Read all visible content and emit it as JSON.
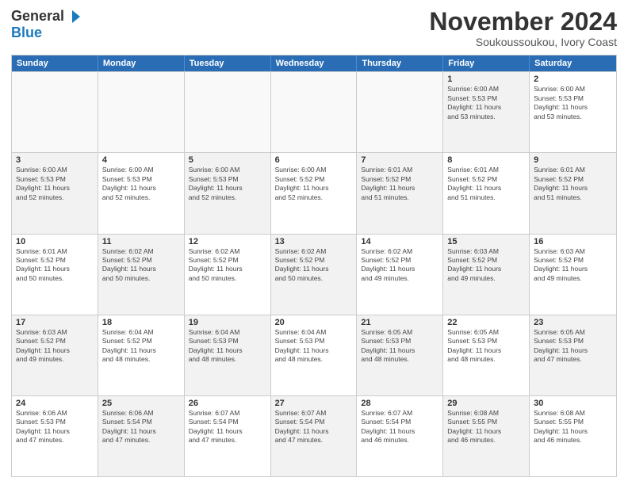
{
  "header": {
    "logo_general": "General",
    "logo_blue": "Blue",
    "month_title": "November 2024",
    "location": "Soukoussoukou, Ivory Coast"
  },
  "days_of_week": [
    "Sunday",
    "Monday",
    "Tuesday",
    "Wednesday",
    "Thursday",
    "Friday",
    "Saturday"
  ],
  "weeks": [
    [
      {
        "day": "",
        "info": "",
        "empty": true
      },
      {
        "day": "",
        "info": "",
        "empty": true
      },
      {
        "day": "",
        "info": "",
        "empty": true
      },
      {
        "day": "",
        "info": "",
        "empty": true
      },
      {
        "day": "",
        "info": "",
        "empty": true
      },
      {
        "day": "1",
        "info": "Sunrise: 6:00 AM\nSunset: 5:53 PM\nDaylight: 11 hours\nand 53 minutes.",
        "shaded": true
      },
      {
        "day": "2",
        "info": "Sunrise: 6:00 AM\nSunset: 5:53 PM\nDaylight: 11 hours\nand 53 minutes.",
        "shaded": false
      }
    ],
    [
      {
        "day": "3",
        "info": "Sunrise: 6:00 AM\nSunset: 5:53 PM\nDaylight: 11 hours\nand 52 minutes.",
        "shaded": true
      },
      {
        "day": "4",
        "info": "Sunrise: 6:00 AM\nSunset: 5:53 PM\nDaylight: 11 hours\nand 52 minutes.",
        "shaded": false
      },
      {
        "day": "5",
        "info": "Sunrise: 6:00 AM\nSunset: 5:53 PM\nDaylight: 11 hours\nand 52 minutes.",
        "shaded": true
      },
      {
        "day": "6",
        "info": "Sunrise: 6:00 AM\nSunset: 5:52 PM\nDaylight: 11 hours\nand 52 minutes.",
        "shaded": false
      },
      {
        "day": "7",
        "info": "Sunrise: 6:01 AM\nSunset: 5:52 PM\nDaylight: 11 hours\nand 51 minutes.",
        "shaded": true
      },
      {
        "day": "8",
        "info": "Sunrise: 6:01 AM\nSunset: 5:52 PM\nDaylight: 11 hours\nand 51 minutes.",
        "shaded": false
      },
      {
        "day": "9",
        "info": "Sunrise: 6:01 AM\nSunset: 5:52 PM\nDaylight: 11 hours\nand 51 minutes.",
        "shaded": true
      }
    ],
    [
      {
        "day": "10",
        "info": "Sunrise: 6:01 AM\nSunset: 5:52 PM\nDaylight: 11 hours\nand 50 minutes.",
        "shaded": false
      },
      {
        "day": "11",
        "info": "Sunrise: 6:02 AM\nSunset: 5:52 PM\nDaylight: 11 hours\nand 50 minutes.",
        "shaded": true
      },
      {
        "day": "12",
        "info": "Sunrise: 6:02 AM\nSunset: 5:52 PM\nDaylight: 11 hours\nand 50 minutes.",
        "shaded": false
      },
      {
        "day": "13",
        "info": "Sunrise: 6:02 AM\nSunset: 5:52 PM\nDaylight: 11 hours\nand 50 minutes.",
        "shaded": true
      },
      {
        "day": "14",
        "info": "Sunrise: 6:02 AM\nSunset: 5:52 PM\nDaylight: 11 hours\nand 49 minutes.",
        "shaded": false
      },
      {
        "day": "15",
        "info": "Sunrise: 6:03 AM\nSunset: 5:52 PM\nDaylight: 11 hours\nand 49 minutes.",
        "shaded": true
      },
      {
        "day": "16",
        "info": "Sunrise: 6:03 AM\nSunset: 5:52 PM\nDaylight: 11 hours\nand 49 minutes.",
        "shaded": false
      }
    ],
    [
      {
        "day": "17",
        "info": "Sunrise: 6:03 AM\nSunset: 5:52 PM\nDaylight: 11 hours\nand 49 minutes.",
        "shaded": true
      },
      {
        "day": "18",
        "info": "Sunrise: 6:04 AM\nSunset: 5:52 PM\nDaylight: 11 hours\nand 48 minutes.",
        "shaded": false
      },
      {
        "day": "19",
        "info": "Sunrise: 6:04 AM\nSunset: 5:53 PM\nDaylight: 11 hours\nand 48 minutes.",
        "shaded": true
      },
      {
        "day": "20",
        "info": "Sunrise: 6:04 AM\nSunset: 5:53 PM\nDaylight: 11 hours\nand 48 minutes.",
        "shaded": false
      },
      {
        "day": "21",
        "info": "Sunrise: 6:05 AM\nSunset: 5:53 PM\nDaylight: 11 hours\nand 48 minutes.",
        "shaded": true
      },
      {
        "day": "22",
        "info": "Sunrise: 6:05 AM\nSunset: 5:53 PM\nDaylight: 11 hours\nand 48 minutes.",
        "shaded": false
      },
      {
        "day": "23",
        "info": "Sunrise: 6:05 AM\nSunset: 5:53 PM\nDaylight: 11 hours\nand 47 minutes.",
        "shaded": true
      }
    ],
    [
      {
        "day": "24",
        "info": "Sunrise: 6:06 AM\nSunset: 5:53 PM\nDaylight: 11 hours\nand 47 minutes.",
        "shaded": false
      },
      {
        "day": "25",
        "info": "Sunrise: 6:06 AM\nSunset: 5:54 PM\nDaylight: 11 hours\nand 47 minutes.",
        "shaded": true
      },
      {
        "day": "26",
        "info": "Sunrise: 6:07 AM\nSunset: 5:54 PM\nDaylight: 11 hours\nand 47 minutes.",
        "shaded": false
      },
      {
        "day": "27",
        "info": "Sunrise: 6:07 AM\nSunset: 5:54 PM\nDaylight: 11 hours\nand 47 minutes.",
        "shaded": true
      },
      {
        "day": "28",
        "info": "Sunrise: 6:07 AM\nSunset: 5:54 PM\nDaylight: 11 hours\nand 46 minutes.",
        "shaded": false
      },
      {
        "day": "29",
        "info": "Sunrise: 6:08 AM\nSunset: 5:55 PM\nDaylight: 11 hours\nand 46 minutes.",
        "shaded": true
      },
      {
        "day": "30",
        "info": "Sunrise: 6:08 AM\nSunset: 5:55 PM\nDaylight: 11 hours\nand 46 minutes.",
        "shaded": false
      }
    ]
  ]
}
